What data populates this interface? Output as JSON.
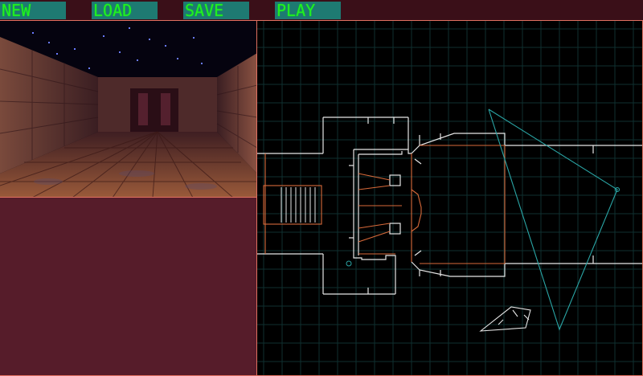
{
  "menu": {
    "new_label": "NEW",
    "load_label": "LOAD",
    "save_label": "SAVE",
    "play_label": "PLAY"
  },
  "colors": {
    "background": "#4a141e",
    "panel": "#561c2a",
    "button_bg": "#1e7a72",
    "button_text": "#22ee22",
    "border": "#e07060",
    "map_grid": "#0e2a2a",
    "map_wall": "#e6e6e6",
    "map_door": "#d86a3a",
    "camera_fov": "#2aa6a6"
  },
  "icons": {
    "camera_marker": "camera-icon",
    "thing_marker": "thing-marker-icon"
  }
}
